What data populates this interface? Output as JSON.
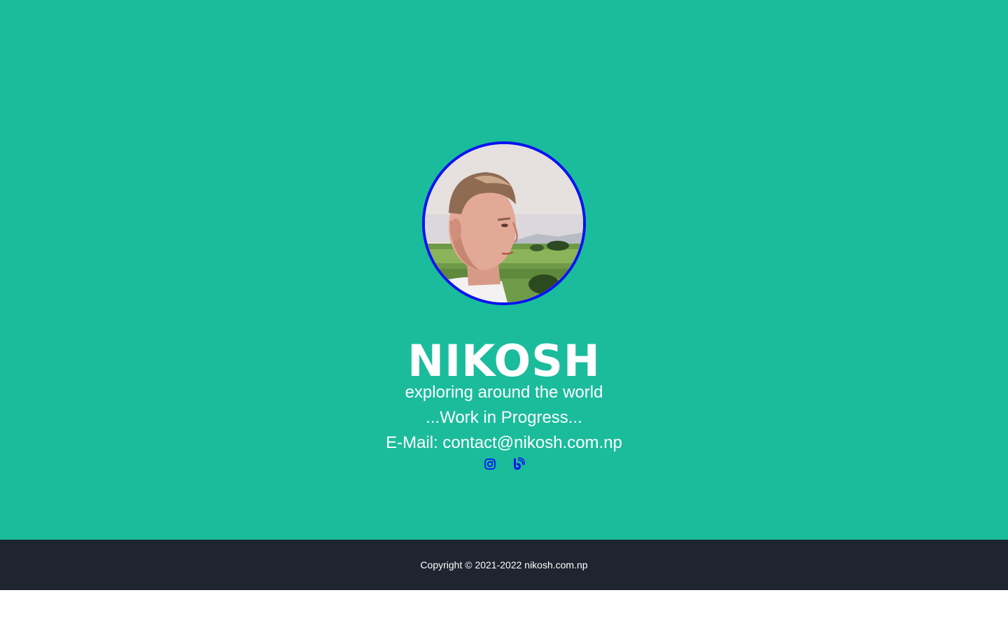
{
  "profile": {
    "name": "NIKOSH",
    "tagline": "exploring around the world",
    "status": "...Work in Progress...",
    "email_line": "E-Mail: contact@nikosh.com.np",
    "avatar_border_color": "#0a12f0"
  },
  "socials": [
    {
      "icon": "instagram-icon"
    },
    {
      "icon": "blog-icon"
    }
  ],
  "footer": {
    "copyright": "Copyright © 2021-2022 nikosh.com.np"
  },
  "colors": {
    "hero_background": "#1abc9c",
    "footer_background": "#1e2530",
    "icon_color": "#0a12f0",
    "text": "#ffffff"
  }
}
